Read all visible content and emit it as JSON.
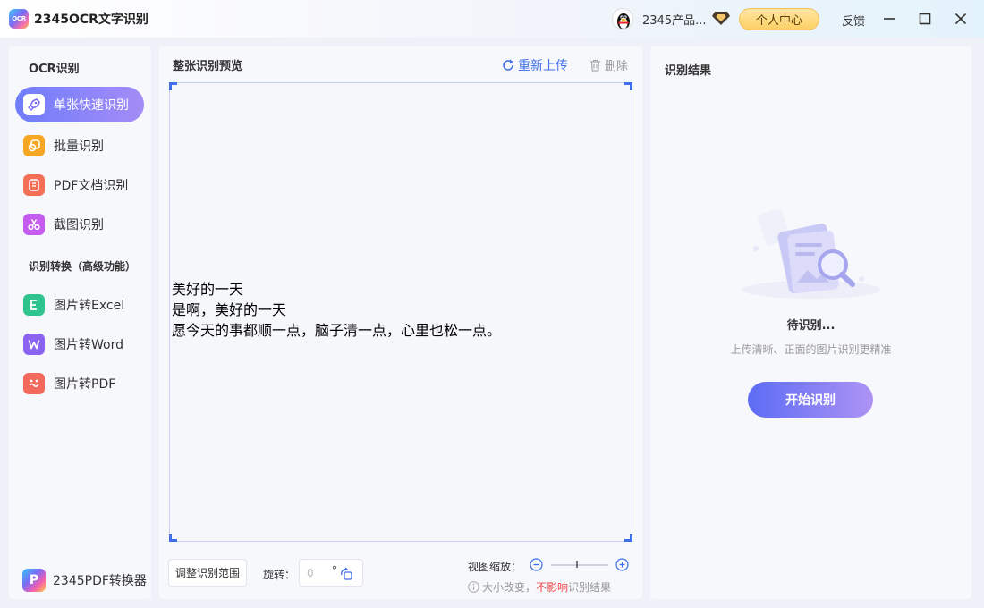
{
  "titlebar": {
    "logo_text": "OCR",
    "app_title": "2345OCR文字识别",
    "user_name": "2345产品...",
    "personal_center": "个人中心",
    "feedback": "反馈"
  },
  "sidebar": {
    "section_ocr": "OCR识别",
    "ocr_items": [
      {
        "label": "单张快速识别",
        "icon": "rocket-icon",
        "color": "#7a6cf5",
        "active": true
      },
      {
        "label": "批量识别",
        "icon": "batch-icon",
        "color": "#f5a623"
      },
      {
        "label": "PDF文档识别",
        "icon": "pdf-doc-icon",
        "color": "#f37056"
      },
      {
        "label": "截图识别",
        "icon": "scissors-icon",
        "color": "#c45cf0"
      }
    ],
    "section_convert": "识别转换（高级功能）",
    "convert_items": [
      {
        "label": "图片转Excel",
        "icon": "excel-icon",
        "color": "#2fc48d"
      },
      {
        "label": "图片转Word",
        "icon": "word-icon",
        "color": "#8a63f0"
      },
      {
        "label": "图片转PDF",
        "icon": "image-pdf-icon",
        "color": "#f36a5c"
      }
    ],
    "pdf_converter": "2345PDF转换器"
  },
  "preview": {
    "title": "整张识别预览",
    "reupload": "重新上传",
    "delete": "删除",
    "lines": [
      "美好的一天",
      "是啊，美好的一天",
      "愿今天的事都顺一点，脑子清一点，心里也松一点。"
    ],
    "adjust_range": "调整识别范围",
    "rotate_label": "旋转：",
    "rotate_value": "0",
    "rotate_unit": "°",
    "zoom_label": "视图缩放：",
    "zoom_level": 0.45,
    "zoom_note_prefix": "大小改变，",
    "zoom_note_warn": "不影响",
    "zoom_note_suffix": "识别结果"
  },
  "result": {
    "title": "识别结果",
    "pending": "待识别...",
    "hint": "上传清晰、正面的图片识别更精准",
    "start_button": "开始识别"
  }
}
